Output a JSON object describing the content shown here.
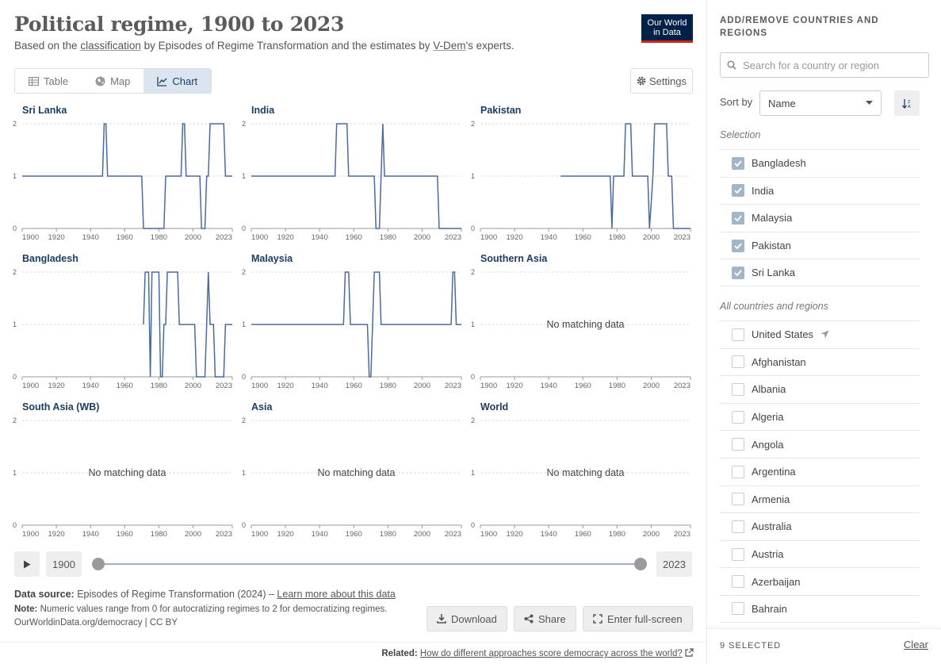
{
  "header": {
    "title": "Political regime, 1900 to 2023",
    "subtitle_pre": "Based on the ",
    "subtitle_link1": "classification",
    "subtitle_mid": " by Episodes of Regime Transformation and the estimates by ",
    "subtitle_link2": "V-Dem",
    "subtitle_post": "'s experts.",
    "logo_line1": "Our World",
    "logo_line2": "in Data"
  },
  "tabs": [
    "Table",
    "Map",
    "Chart"
  ],
  "active_tab": "Chart",
  "settings_label": "Settings",
  "timeline": {
    "start": "1900",
    "end": "2023"
  },
  "footer": {
    "source_label": "Data source:",
    "source_text": " Episodes of Regime Transformation (2024) – ",
    "source_link": "Learn more about this data",
    "note_label": "Note:",
    "note_text": " Numeric values range from 0 for autocratizing regimes to 2 for democratizing regimes.",
    "url": "OurWorldinData.org/democracy | CC BY",
    "download": "Download",
    "share": "Share",
    "fullscreen": "Enter full-screen",
    "related_label": "Related:",
    "related_link": "How do different approaches score democracy across the world?"
  },
  "sidebar": {
    "heading": "ADD/REMOVE COUNTRIES AND REGIONS",
    "search_placeholder": "Search for a country or region",
    "sort_label": "Sort by",
    "sort_value": "Name",
    "selection_label": "Selection",
    "selected": [
      "Bangladesh",
      "India",
      "Malaysia",
      "Pakistan",
      "Sri Lanka"
    ],
    "all_label": "All countries and regions",
    "all": [
      "United States",
      "Afghanistan",
      "Albania",
      "Algeria",
      "Angola",
      "Argentina",
      "Armenia",
      "Australia",
      "Austria",
      "Azerbaijan",
      "Bahrain"
    ],
    "selected_count": "9 SELECTED",
    "clear": "Clear"
  },
  "colors": {
    "line": "#4c6a9c",
    "title": "#1d3d63"
  },
  "chart_data": [
    {
      "type": "line",
      "title": "Sri Lanka",
      "ylim": [
        0,
        2
      ],
      "xticks": [
        "1900",
        "1920",
        "1940",
        "1960",
        "1980",
        "2000",
        "2023"
      ],
      "points": [
        [
          1900,
          1
        ],
        [
          1947,
          1
        ],
        [
          1948,
          2
        ],
        [
          1949,
          2
        ],
        [
          1950,
          1
        ],
        [
          1970,
          1
        ],
        [
          1971,
          0
        ],
        [
          1983,
          0
        ],
        [
          1984,
          1
        ],
        [
          1993,
          1
        ],
        [
          1994,
          2
        ],
        [
          1995,
          2
        ],
        [
          1996,
          1
        ],
        [
          2004,
          1
        ],
        [
          2005,
          0
        ],
        [
          2007,
          0
        ],
        [
          2008,
          1
        ],
        [
          2009,
          1
        ],
        [
          2010,
          2
        ],
        [
          2018,
          2
        ],
        [
          2019,
          1
        ],
        [
          2023,
          1
        ]
      ]
    },
    {
      "type": "line",
      "title": "India",
      "ylim": [
        0,
        2
      ],
      "xticks": [
        "1900",
        "1920",
        "1940",
        "1960",
        "1980",
        "2000",
        "2023"
      ],
      "points": [
        [
          1900,
          1
        ],
        [
          1949,
          1
        ],
        [
          1950,
          2
        ],
        [
          1956,
          2
        ],
        [
          1957,
          1
        ],
        [
          1972,
          1
        ],
        [
          1973,
          0
        ],
        [
          1975,
          0
        ],
        [
          1976,
          1
        ],
        [
          1977,
          2
        ],
        [
          1978,
          1
        ],
        [
          2009,
          1
        ],
        [
          2010,
          0
        ],
        [
          2023,
          0
        ]
      ]
    },
    {
      "type": "line",
      "title": "Pakistan",
      "ylim": [
        0,
        2
      ],
      "xticks": [
        "1900",
        "1920",
        "1940",
        "1960",
        "1980",
        "2000",
        "2023"
      ],
      "points": [
        [
          1947,
          1
        ],
        [
          1976,
          1
        ],
        [
          1977,
          0
        ],
        [
          1978,
          1
        ],
        [
          1984,
          1
        ],
        [
          1985,
          2
        ],
        [
          1988,
          2
        ],
        [
          1989,
          1
        ],
        [
          1998,
          1
        ],
        [
          1999,
          0
        ],
        [
          2001,
          1
        ],
        [
          2002,
          2
        ],
        [
          2009,
          2
        ],
        [
          2010,
          1
        ],
        [
          2012,
          1
        ],
        [
          2013,
          0
        ],
        [
          2023,
          0
        ]
      ]
    },
    {
      "type": "line",
      "title": "Bangladesh",
      "ylim": [
        0,
        2
      ],
      "xticks": [
        "1900",
        "1920",
        "1940",
        "1960",
        "1980",
        "2000",
        "2023"
      ],
      "points": [
        [
          1971,
          1
        ],
        [
          1972,
          2
        ],
        [
          1974,
          2
        ],
        [
          1975,
          0
        ],
        [
          1976,
          2
        ],
        [
          1980,
          2
        ],
        [
          1981,
          0
        ],
        [
          1982,
          0
        ],
        [
          1983,
          1
        ],
        [
          1984,
          1
        ],
        [
          1985,
          2
        ],
        [
          1991,
          2
        ],
        [
          1992,
          1
        ],
        [
          2001,
          1
        ],
        [
          2002,
          0
        ],
        [
          2007,
          0
        ],
        [
          2008,
          1
        ],
        [
          2009,
          2
        ],
        [
          2010,
          1
        ],
        [
          2012,
          1
        ],
        [
          2013,
          0
        ],
        [
          2018,
          0
        ],
        [
          2019,
          1
        ],
        [
          2023,
          1
        ]
      ]
    },
    {
      "type": "line",
      "title": "Malaysia",
      "ylim": [
        0,
        2
      ],
      "xticks": [
        "1900",
        "1920",
        "1940",
        "1960",
        "1980",
        "2000",
        "2023"
      ],
      "points": [
        [
          1900,
          1
        ],
        [
          1954,
          1
        ],
        [
          1955,
          2
        ],
        [
          1957,
          2
        ],
        [
          1958,
          1
        ],
        [
          1968,
          1
        ],
        [
          1969,
          0
        ],
        [
          1970,
          0
        ],
        [
          1971,
          1
        ],
        [
          1972,
          2
        ],
        [
          1975,
          2
        ],
        [
          1976,
          1
        ],
        [
          2017,
          1
        ],
        [
          2018,
          2
        ],
        [
          2019,
          2
        ],
        [
          2020,
          1
        ],
        [
          2023,
          1
        ]
      ]
    },
    {
      "type": "line",
      "title": "Southern Asia",
      "ylim": [
        0,
        2
      ],
      "xticks": [
        "1900",
        "1920",
        "1940",
        "1960",
        "1980",
        "2000",
        "2023"
      ],
      "points": [],
      "message": "No matching data"
    },
    {
      "type": "line",
      "title": "South Asia (WB)",
      "ylim": [
        0,
        2
      ],
      "xticks": [
        "1900",
        "1920",
        "1940",
        "1960",
        "1980",
        "2000",
        "2023"
      ],
      "points": [],
      "message": "No matching data"
    },
    {
      "type": "line",
      "title": "Asia",
      "ylim": [
        0,
        2
      ],
      "xticks": [
        "1900",
        "1920",
        "1940",
        "1960",
        "1980",
        "2000",
        "2023"
      ],
      "points": [],
      "message": "No matching data"
    },
    {
      "type": "line",
      "title": "World",
      "ylim": [
        0,
        2
      ],
      "xticks": [
        "1900",
        "1920",
        "1940",
        "1960",
        "1980",
        "2000",
        "2023"
      ],
      "points": [],
      "message": "No matching data"
    }
  ]
}
